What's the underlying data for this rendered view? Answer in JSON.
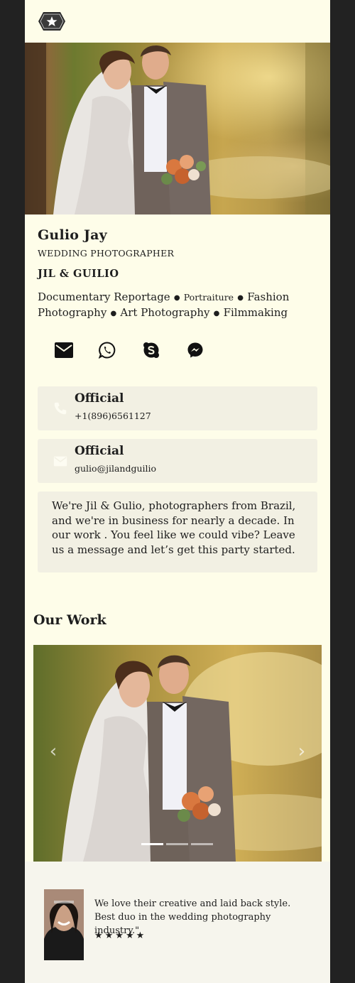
{
  "header": {
    "logo_icon": "star-badge-icon"
  },
  "hero": {
    "image_subject": "wedding couple photo"
  },
  "profile": {
    "name": "Gulio Jay",
    "role": "WEDDING PHOTOGRAPHER",
    "brand": "JIL & GUILIO",
    "services": [
      "Documentary Reportage",
      "Portraiture",
      "Fashion Photography",
      "Art Photography",
      "Filmmaking"
    ]
  },
  "social": [
    "email-icon",
    "whatsapp-icon",
    "skype-icon",
    "messenger-icon"
  ],
  "contacts": [
    {
      "icon": "phone-icon",
      "title": "Official",
      "value": "+1(896)6561127"
    },
    {
      "icon": "mail-icon",
      "title": "Official",
      "value": "gulio@jilandguilio"
    }
  ],
  "about": "We're Jil & Gulio, photographers from Brazil, and we're in business for nearly a decade. In our work . You feel like we could vibe? Leave us a message and let’s get this party started.",
  "our_work": {
    "title": "Our Work",
    "prev": "‹",
    "next": "›",
    "active_slide": 1,
    "slide_count": 3
  },
  "testimonial": {
    "quote": "We love their creative and laid back style. Best duo in the wedding photography industry.\"",
    "stars": "★★★★★",
    "rating": 5
  },
  "colors": {
    "page_bg": "#fefde9",
    "card_bg": "#f2f0e3",
    "outer_bg": "#222222",
    "text": "#1e1e1e"
  }
}
